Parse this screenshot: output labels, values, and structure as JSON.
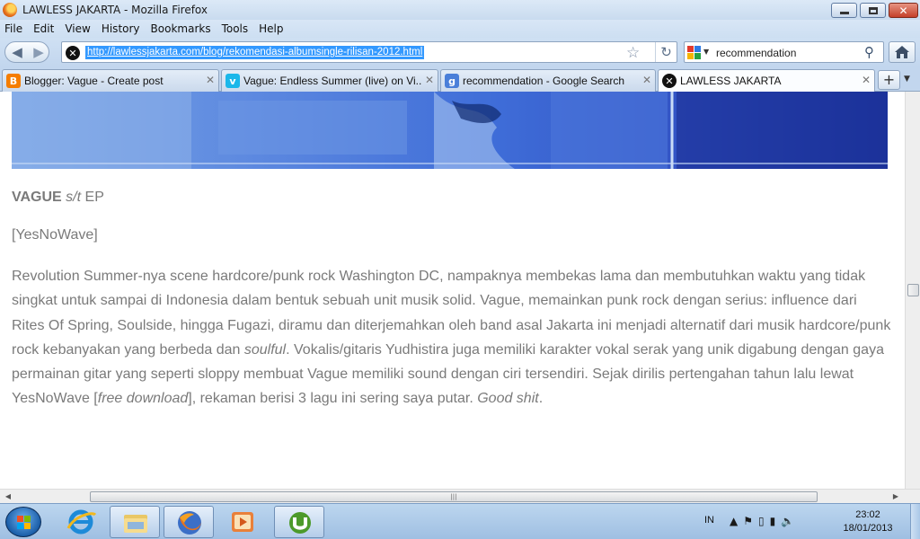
{
  "window": {
    "title": "LAWLESS JAKARTA - Mozilla Firefox"
  },
  "menu": [
    "File",
    "Edit",
    "View",
    "History",
    "Bookmarks",
    "Tools",
    "Help"
  ],
  "address_bar": {
    "url": "http://lawlessjakarta.com/blog/rekomendasi-albumsingle-rilisan-2012.html"
  },
  "search_bar": {
    "engine": "Google",
    "query": "recommendation"
  },
  "tabs": [
    {
      "label": "Blogger: Vague - Create post",
      "icon": "blogger-icon",
      "icon_color": "#f57d00",
      "active": false
    },
    {
      "label": "Vague: Endless Summer (live) on Vi...",
      "icon": "vimeo-icon",
      "icon_color": "#1ab7ea",
      "active": false
    },
    {
      "label": "recommendation - Google Search",
      "icon": "google-icon",
      "icon_color": "#4a7fd9",
      "active": false
    },
    {
      "label": "LAWLESS JAKARTA",
      "icon": "lawless-icon",
      "icon_color": "#111111",
      "active": true
    }
  ],
  "article": {
    "band": "VAGUE",
    "release_title": "s/t",
    "release_type": "EP",
    "label": "[YesNoWave]",
    "body": [
      {
        "text": "Revolution Summer-nya scene hardcore/punk rock Washington DC, nampaknya membekas lama dan membutuhkan waktu yang tidak singkat untuk sampai di Indonesia dalam bentuk sebuah unit musik solid. Vague, memainkan punk rock dengan serius: influence dari Rites Of Spring, Soulside, hingga Fugazi, diramu dan diterjemahkan oleh band asal Jakarta ini menjadi alternatif dari musik hardcore/punk rock kebanyakan yang berbeda dan ",
        "italic": false
      },
      {
        "text": "soulful",
        "italic": true
      },
      {
        "text": ". Vokalis/gitaris Yudhistira juga memiliki karakter vokal serak yang unik digabung dengan gaya permainan gitar yang seperti sloppy membuat Vague memiliki sound dengan ciri tersendiri. Sejak dirilis pertengahan tahun lalu lewat YesNoWave [",
        "italic": false
      },
      {
        "text": "free download",
        "italic": true
      },
      {
        "text": "], rekaman berisi 3 lagu ini sering saya putar. ",
        "italic": false
      },
      {
        "text": "Good shit",
        "italic": true
      },
      {
        "text": ".",
        "italic": false
      }
    ]
  },
  "taskbar": {
    "apps": [
      "internet-explorer",
      "windows-explorer",
      "firefox",
      "media-player",
      "utorrent"
    ],
    "language": "IN",
    "clock_time": "23:02",
    "clock_date": "18/01/2013"
  },
  "colors": {
    "link_selection": "#3399ff",
    "article_text": "#7a7a7a",
    "banner_blue": "#3f6dd8"
  }
}
